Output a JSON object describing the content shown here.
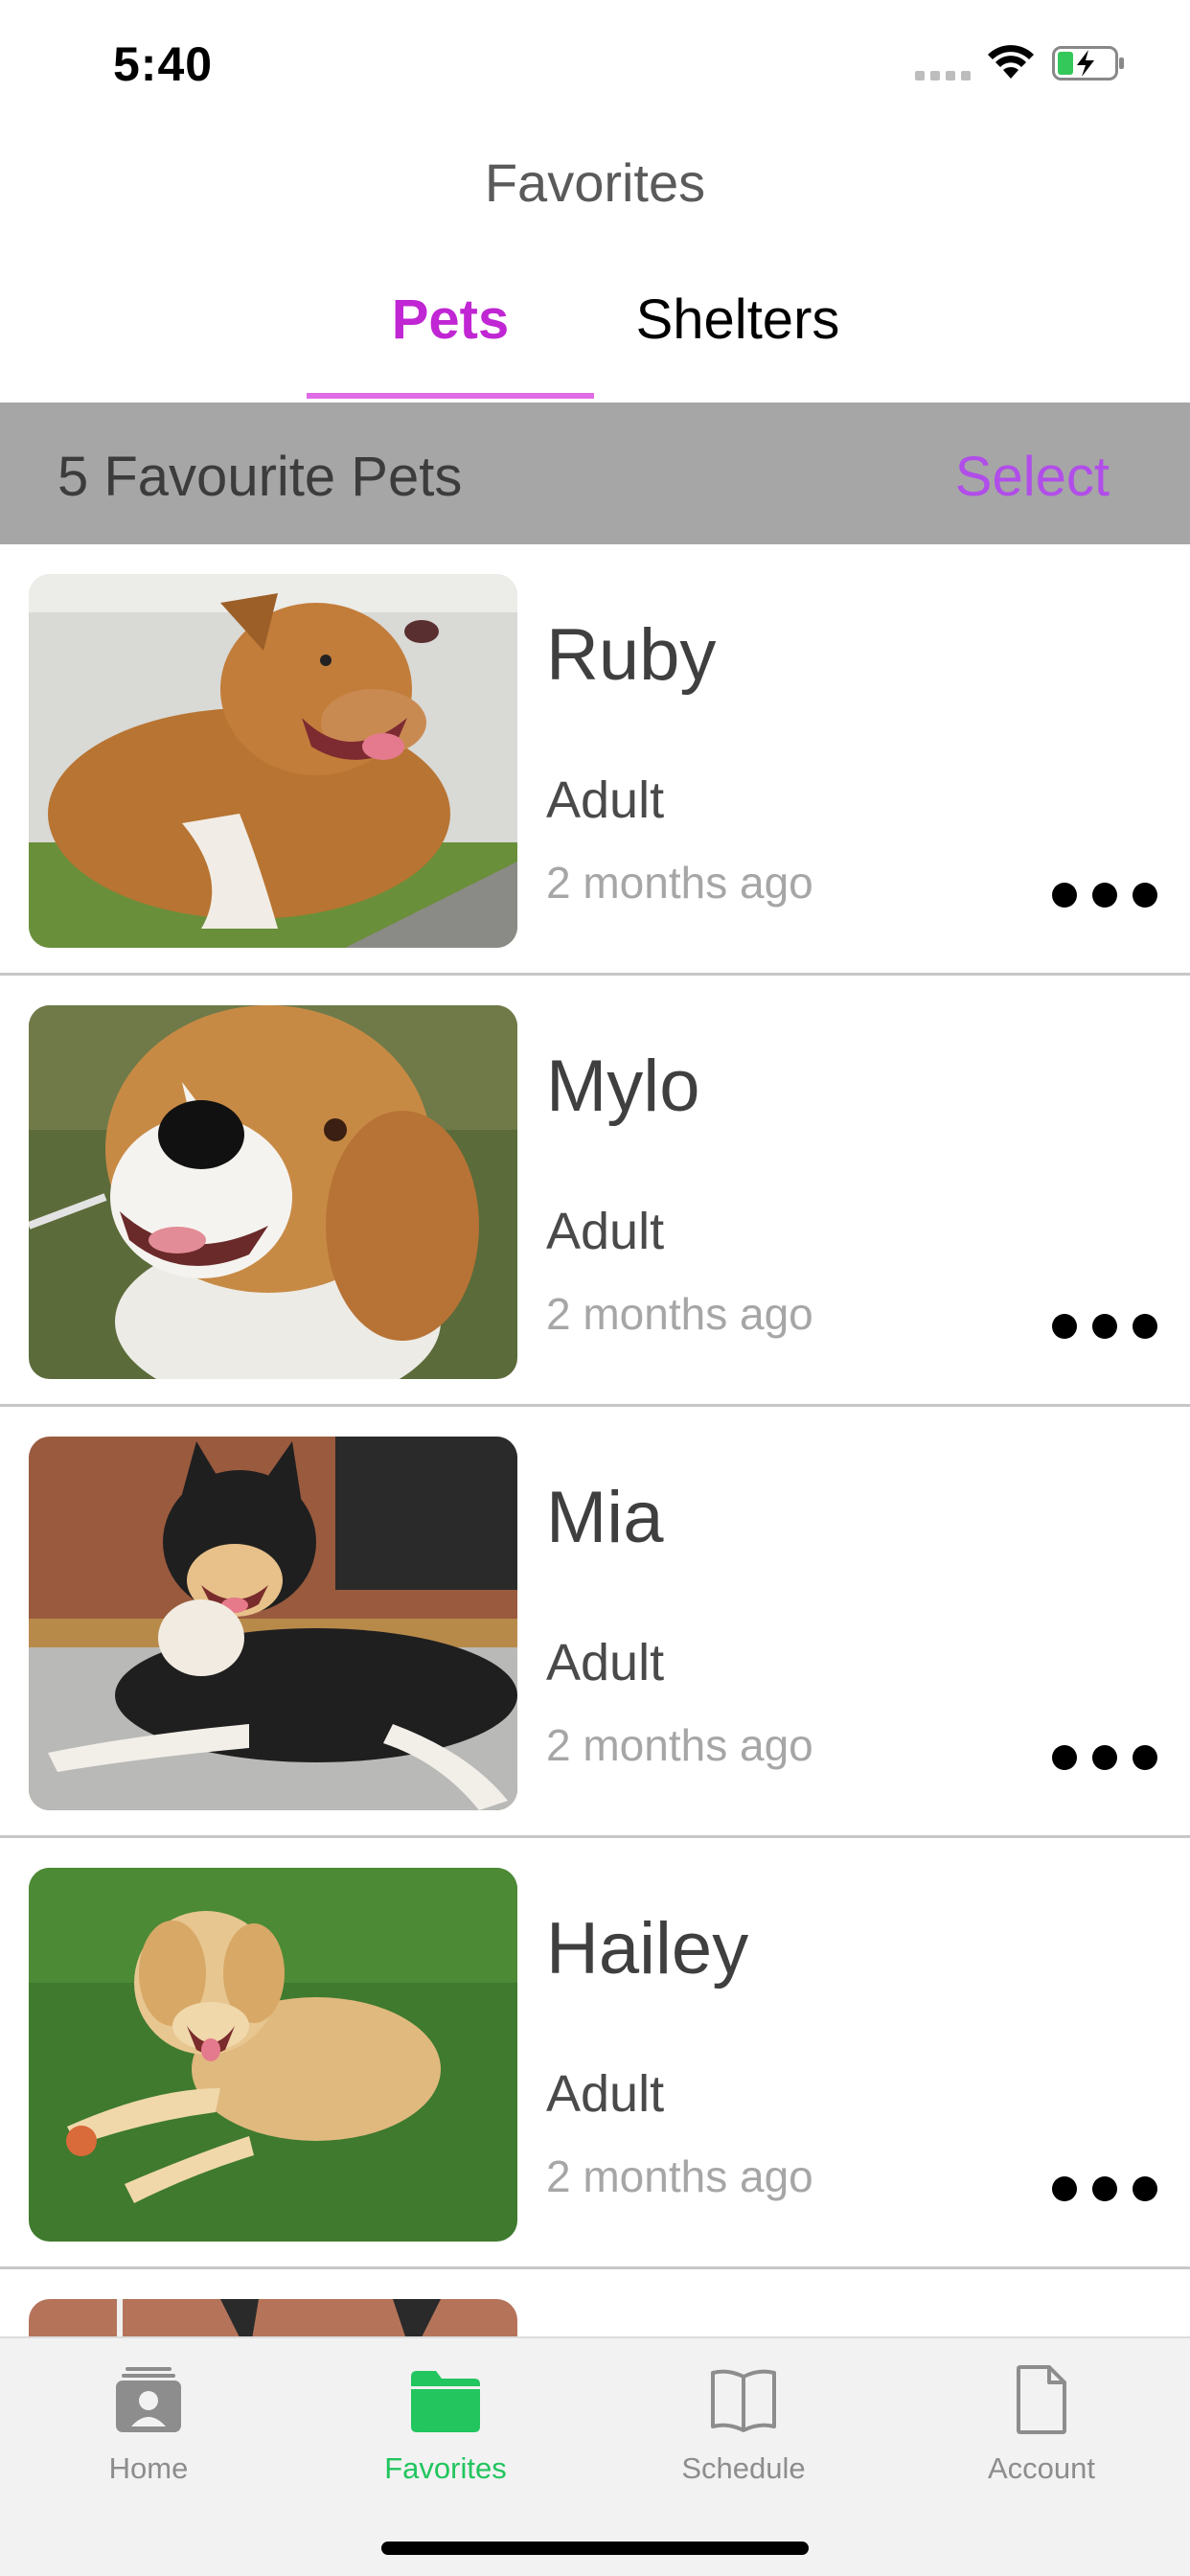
{
  "status_bar": {
    "time": "5:40"
  },
  "header": {
    "title": "Favorites"
  },
  "tabs": {
    "pets": "Pets",
    "shelters": "Shelters",
    "selected": "Pets"
  },
  "list_header": {
    "count_label": "5 Favourite Pets",
    "select_label": "Select"
  },
  "pets": [
    {
      "name": "Ruby",
      "age": "Adult",
      "time": "2 months ago"
    },
    {
      "name": "Mylo",
      "age": "Adult",
      "time": "2 months ago"
    },
    {
      "name": "Mia",
      "age": "Adult",
      "time": "2 months ago"
    },
    {
      "name": "Hailey",
      "age": "Adult",
      "time": "2 months ago"
    }
  ],
  "tab_bar": {
    "items": [
      {
        "label": "Home",
        "icon": "contact-card-icon"
      },
      {
        "label": "Favorites",
        "icon": "folder-icon"
      },
      {
        "label": "Schedule",
        "icon": "book-icon"
      },
      {
        "label": "Account",
        "icon": "document-icon"
      }
    ],
    "active": "Favorites"
  },
  "colors": {
    "accent": "#c026d3",
    "select": "#b14de9",
    "active_tab": "#22c55e"
  }
}
